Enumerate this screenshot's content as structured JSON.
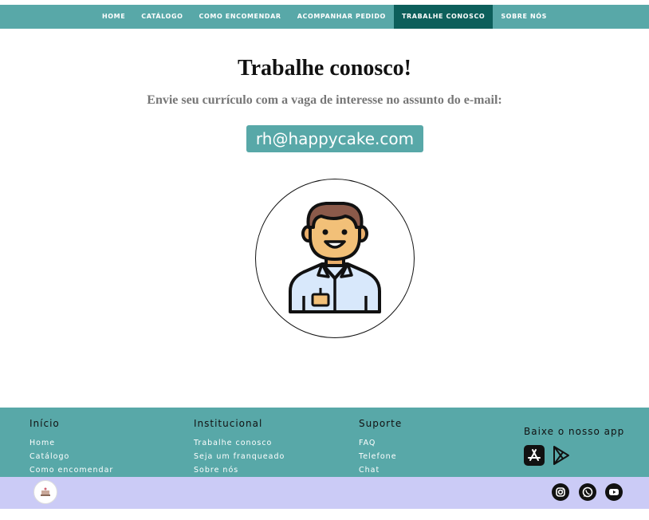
{
  "nav": {
    "items": [
      "HOME",
      "CATÁLOGO",
      "COMO ENCOMENDAR",
      "ACOMPANHAR PEDIDO",
      "TRABALHE CONOSCO",
      "SOBRE NÓS"
    ],
    "active": "TRABALHE CONOSCO"
  },
  "main": {
    "title": "Trabalhe conosco!",
    "subtitle": "Envie seu currículo com a vaga de interesse no assunto do e-mail:",
    "email": "rh@happycake.com",
    "illustration_icon": "man-avatar-icon"
  },
  "footer": {
    "col1": {
      "heading": "Início",
      "links": [
        "Home",
        "Catálogo",
        "Como encomendar"
      ]
    },
    "col2": {
      "heading": "Institucional",
      "links": [
        "Trabalhe conosco",
        "Seja um franqueado",
        "Sobre nós"
      ]
    },
    "col3": {
      "heading": "Suporte",
      "links": [
        "FAQ",
        "Telefone",
        "Chat"
      ]
    },
    "app": {
      "heading": "Baixe o nosso app",
      "icons": [
        "app-store-icon",
        "google-play-icon"
      ]
    }
  },
  "bottom": {
    "logo_icon": "happycake-logo",
    "social_icons": [
      "instagram-icon",
      "whatsapp-icon",
      "youtube-icon"
    ]
  },
  "colors": {
    "teal": "#58a8a8",
    "teal_dark": "#0d5f5b",
    "lavender": "#cbcbf6"
  }
}
